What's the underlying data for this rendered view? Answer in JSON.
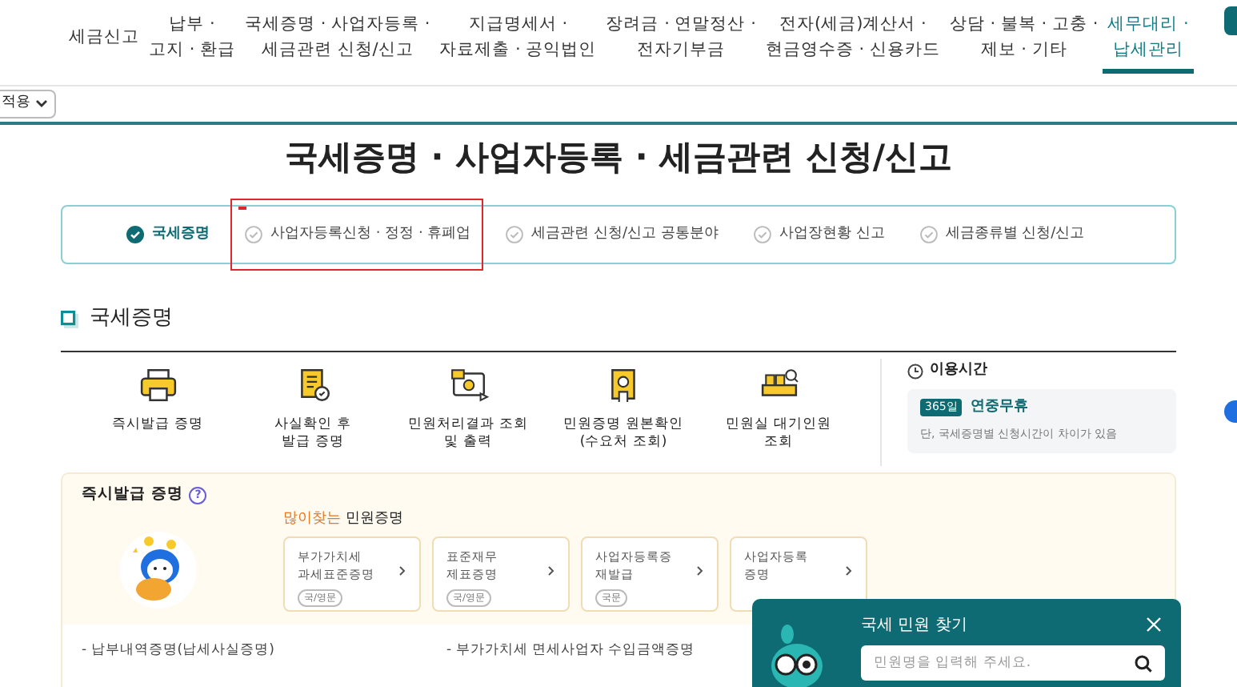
{
  "nav": {
    "items": [
      {
        "lines": [
          "세금신고"
        ],
        "selected": false
      },
      {
        "lines": [
          "납부 ·",
          "고지 · 환급"
        ],
        "selected": false
      },
      {
        "lines": [
          "국세증명 · 사업자등록 ·",
          "세금관련 신청/신고"
        ],
        "selected": false
      },
      {
        "lines": [
          "지급명세서 ·",
          "자료제출 · 공익법인"
        ],
        "selected": false
      },
      {
        "lines": [
          "장려금 · 연말정산 ·",
          "전자기부금"
        ],
        "selected": false
      },
      {
        "lines": [
          "전자(세금)계산서 ·",
          "현금영수증 · 신용카드"
        ],
        "selected": false
      },
      {
        "lines": [
          "상담 · 불복 · 고충 ·",
          "제보 · 기타"
        ],
        "selected": false
      },
      {
        "lines": [
          "세무대리 ·",
          "납세관리"
        ],
        "selected": true
      }
    ]
  },
  "filter": {
    "label": "적용"
  },
  "page_title": "국세증명 · 사업자등록 · 세금관련 신청/신고",
  "tabs": [
    {
      "label": "국세증명",
      "selected": true
    },
    {
      "label": "사업자등록신청 · 정정 · 휴폐업",
      "selected": false
    },
    {
      "label": "세금관련 신청/신고 공통분야",
      "selected": false
    },
    {
      "label": "사업장현황 신고",
      "selected": false
    },
    {
      "label": "세금종류별 신청/신고",
      "selected": false
    }
  ],
  "section": {
    "title": "국세증명"
  },
  "services": [
    {
      "kind": "printer",
      "lines": [
        "즉시발급 증명"
      ]
    },
    {
      "kind": "document",
      "lines": [
        "사실확인 후",
        "발급 증명"
      ]
    },
    {
      "kind": "monitor",
      "lines": [
        "민원처리결과 조회",
        "및 출력"
      ]
    },
    {
      "kind": "certificate",
      "lines": [
        "민원증명 원본확인",
        "(수요처 조회)"
      ]
    },
    {
      "kind": "waiting",
      "lines": [
        "민원실 대기인원",
        "조회"
      ]
    }
  ],
  "usage": {
    "title": "이용시간",
    "badge": "365일",
    "headline": "연중무휴",
    "note": "단, 국세증명별 신청시간이 차이가 있음"
  },
  "instant": {
    "title": "즉시발급 증명",
    "help": "?",
    "popular_highlight": "많이찾는",
    "popular_rest": "민원증명",
    "cards": [
      {
        "lines": [
          "부가가치세",
          "과세표준증명"
        ],
        "tag": "국/영문"
      },
      {
        "lines": [
          "표준재무",
          "제표증명"
        ],
        "tag": "국/영문"
      },
      {
        "lines": [
          "사업자등록증",
          "재발급"
        ],
        "tag": "국문"
      },
      {
        "lines": [
          "사업자등록",
          "증명"
        ]
      }
    ],
    "links": [
      "- 납부내역증명(납세사실증명)",
      "- 부가가치세 면세사업자 수입금액증명"
    ]
  },
  "search_popup": {
    "title": "국세 민원 찾기",
    "placeholder": "민원명을 입력해 주세요."
  }
}
